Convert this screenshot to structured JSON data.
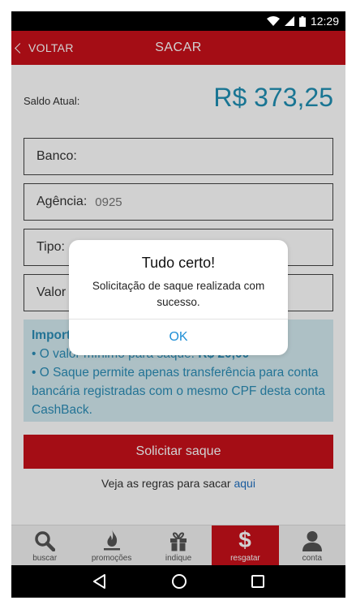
{
  "status_bar": {
    "time": "12:29"
  },
  "app_bar": {
    "back_label": "VOLTAR",
    "title": "SACAR"
  },
  "balance": {
    "label": "Saldo Atual:",
    "value": "R$ 373,25"
  },
  "form": {
    "banco": {
      "label": "Banco:",
      "value": ""
    },
    "agencia": {
      "label": "Agência:",
      "value": "0925"
    },
    "tipo": {
      "label": "Tipo:",
      "value": ""
    },
    "valor": {
      "label": "Valor",
      "value": ""
    }
  },
  "info": {
    "heading": "Importante",
    "line1_prefix": "• O valor mínimo para saque: ",
    "line1_amount": "R$ 20,00",
    "line2": "• O Saque permite apenas transferência para conta bancária registradas com o mesmo CPF desta conta CashBack."
  },
  "submit_button": "Solicitar saque",
  "rules": {
    "text": "Veja as regras para sacar ",
    "link": "aqui"
  },
  "tabs": [
    {
      "label": "buscar",
      "icon": "search-icon"
    },
    {
      "label": "promoções",
      "icon": "flame-icon"
    },
    {
      "label": "indique",
      "icon": "gift-icon"
    },
    {
      "label": "resgatar",
      "icon": "dollar-icon",
      "active": true
    },
    {
      "label": "conta",
      "icon": "user-icon"
    }
  ],
  "dialog": {
    "title": "Tudo certo!",
    "message": "Solicitação de saque realizada com sucesso.",
    "ok_label": "OK"
  },
  "colors": {
    "brand_red": "#c8101a",
    "accent_blue": "#1f8fb4",
    "info_bg": "#d4ebf1"
  }
}
